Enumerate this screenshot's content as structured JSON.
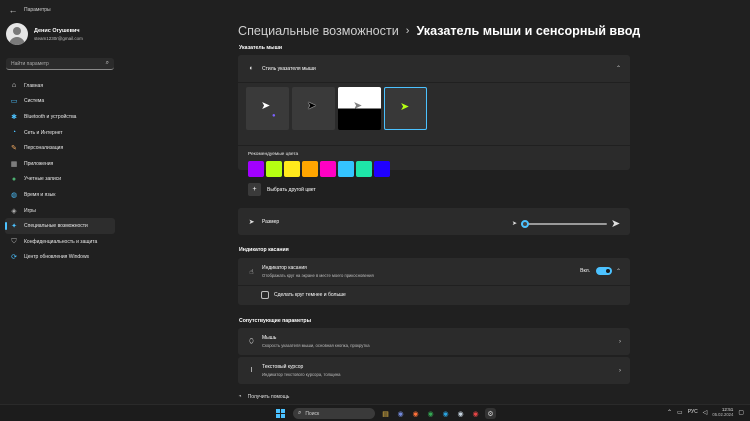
{
  "window": {
    "back_glyph": "←",
    "app_title": "Параметры"
  },
  "profile": {
    "name": "Денис Огушевич",
    "email": "steam1230r@gmail.com"
  },
  "search": {
    "placeholder": "Найти параметр"
  },
  "sidebar": {
    "items": [
      {
        "label": "Главная",
        "icon": "home-icon",
        "glyph": "⌂",
        "color": "#e8e8e8"
      },
      {
        "label": "Система",
        "icon": "monitor-icon",
        "glyph": "▭",
        "color": "#4cc2ff"
      },
      {
        "label": "Bluetooth и устройства",
        "icon": "bluetooth-icon",
        "glyph": "✱",
        "color": "#4cc2ff"
      },
      {
        "label": "Сеть и Интернет",
        "icon": "wifi-icon",
        "glyph": "◔",
        "color": "#4cc2ff"
      },
      {
        "label": "Персонализация",
        "icon": "brush-icon",
        "glyph": "✎",
        "color": "#f0a860"
      },
      {
        "label": "Приложения",
        "icon": "apps-icon",
        "glyph": "▦",
        "color": "#b0b0b0"
      },
      {
        "label": "Учетные записи",
        "icon": "person-icon",
        "glyph": "●",
        "color": "#4caf70"
      },
      {
        "label": "Время и язык",
        "icon": "globe-icon",
        "glyph": "◍",
        "color": "#4cc2ff"
      },
      {
        "label": "Игры",
        "icon": "gamepad-icon",
        "glyph": "◈",
        "color": "#b0b0b0"
      },
      {
        "label": "Специальные возможности",
        "icon": "accessibility-icon",
        "glyph": "✦",
        "color": "#4cc2ff",
        "active": true
      },
      {
        "label": "Конфиденциальность и защита",
        "icon": "shield-icon",
        "glyph": "⛉",
        "color": "#b0b0b0"
      },
      {
        "label": "Центр обновления Windows",
        "icon": "update-icon",
        "glyph": "⟳",
        "color": "#4cc2ff"
      }
    ]
  },
  "breadcrumb": {
    "parent": "Специальные возможности",
    "separator": "›",
    "current": "Указатель мыши и сенсорный ввод"
  },
  "pointer_section": {
    "heading": "Указатель мыши",
    "style_label": "Стиль указателя мыши",
    "style_icon": "pointer-style-icon",
    "chevron": "⌃",
    "styles": [
      {
        "name": "white",
        "icon": "white-cursor-icon"
      },
      {
        "name": "black",
        "icon": "black-cursor-icon"
      },
      {
        "name": "inverted",
        "icon": "inverted-cursor-icon"
      },
      {
        "name": "custom",
        "icon": "custom-cursor-icon",
        "selected": true
      }
    ],
    "colors_label": "Рекомендуемые цвета",
    "colors": [
      "#a200ff",
      "#b5ff12",
      "#ffe91c",
      "#ffa500",
      "#ff00c3",
      "#34c4ff",
      "#1ee6a8",
      "#1f00ff"
    ],
    "custom_color_label": "Выбрать другой цвет",
    "size_label": "Размер",
    "size_value": 0.05
  },
  "touch_section": {
    "heading": "Индикатор касания",
    "indicator_label": "Индикатор касания",
    "indicator_sub": "Отображать круг на экране в месте моего прикосновения",
    "toggle_state": "Вкл.",
    "checkbox_label": "Сделать круг темнее и больше"
  },
  "related_section": {
    "heading": "Сопутствующие параметры",
    "items": [
      {
        "label": "Мышь",
        "sub": "Скорость указателя мыши, основная кнопка, прокрутка",
        "icon": "mouse-icon"
      },
      {
        "label": "Текстовый курсор",
        "sub": "Индикатор текстового курсора, толщина",
        "icon": "text-cursor-icon"
      }
    ]
  },
  "help": {
    "label": "Получить помощь"
  },
  "taskbar": {
    "search_label": "Поиск",
    "apps": [
      {
        "icon": "explorer-icon",
        "glyph": "▤",
        "color": "#f7c648"
      },
      {
        "icon": "discord-icon",
        "glyph": "◉",
        "color": "#7289da"
      },
      {
        "icon": "firefox-icon",
        "glyph": "◉",
        "color": "#ff7139"
      },
      {
        "icon": "chrome-icon",
        "glyph": "◉",
        "color": "#34a853"
      },
      {
        "icon": "telegram-icon",
        "glyph": "◉",
        "color": "#2aa3df"
      },
      {
        "icon": "steam-icon",
        "glyph": "◉",
        "color": "#c7d5e0"
      },
      {
        "icon": "recorder-icon",
        "glyph": "◉",
        "color": "#e64545"
      },
      {
        "icon": "settings-icon",
        "glyph": "⚙",
        "color": "#cfcfcf",
        "active": true
      }
    ],
    "language": "РУС",
    "time": "12:51",
    "date": "05.02.2024"
  }
}
